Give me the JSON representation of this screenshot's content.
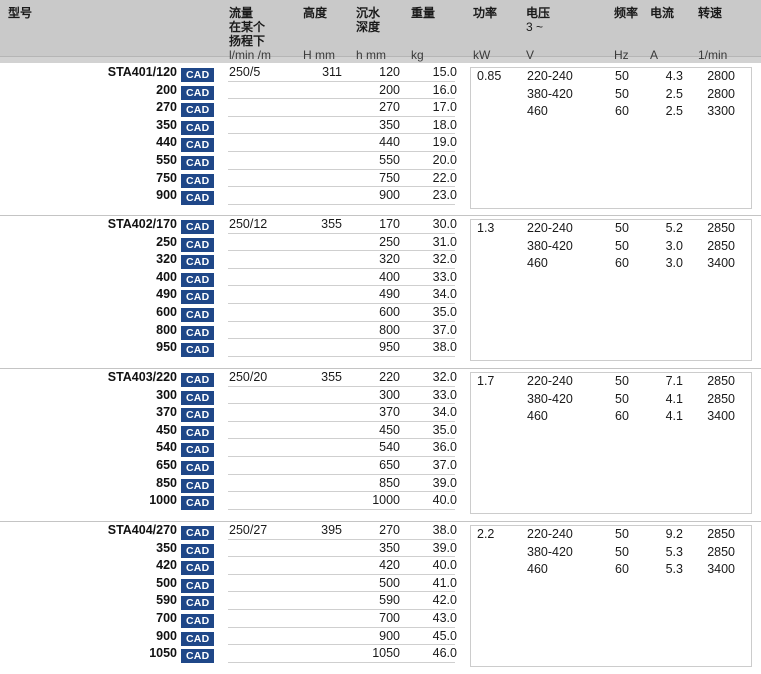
{
  "table": {
    "columns": [
      {
        "key": "model",
        "zh": "型号",
        "sub": "",
        "unit": ""
      },
      {
        "key": "flow",
        "zh": "流量",
        "sub2": "在某个",
        "sub3": "扬程下",
        "unit": "l/min /m"
      },
      {
        "key": "height",
        "zh": "高度",
        "unit": "H mm"
      },
      {
        "key": "depth",
        "zh": "沉水",
        "sub2": "深度",
        "unit": "h mm"
      },
      {
        "key": "weight",
        "zh": "重量",
        "unit": "kg"
      },
      {
        "key": "power",
        "zh": "功率",
        "unit": "kW"
      },
      {
        "key": "voltage",
        "zh": "电压",
        "sub2": "3 ~",
        "unit": "V"
      },
      {
        "key": "freq",
        "zh": "频率",
        "unit": "Hz"
      },
      {
        "key": "current",
        "zh": "电流",
        "unit": "A"
      },
      {
        "key": "speed",
        "zh": "转速",
        "unit": "1/min"
      }
    ],
    "cad_label": "CAD",
    "accent_color": "#1f4788",
    "header_bg": "#c9c9c9",
    "blocks": [
      {
        "rows": [
          {
            "model": "STA401/120",
            "cad": "CAD",
            "flow": "250/5",
            "height": "311",
            "depth": "120",
            "weight": "15.0"
          },
          {
            "model": "200",
            "cad": "CAD",
            "flow": "",
            "height": "",
            "depth": "200",
            "weight": "16.0"
          },
          {
            "model": "270",
            "cad": "CAD",
            "flow": "",
            "height": "",
            "depth": "270",
            "weight": "17.0"
          },
          {
            "model": "350",
            "cad": "CAD",
            "flow": "",
            "height": "",
            "depth": "350",
            "weight": "18.0"
          },
          {
            "model": "440",
            "cad": "CAD",
            "flow": "",
            "height": "",
            "depth": "440",
            "weight": "19.0"
          },
          {
            "model": "550",
            "cad": "CAD",
            "flow": "",
            "height": "",
            "depth": "550",
            "weight": "20.0"
          },
          {
            "model": "750",
            "cad": "CAD",
            "flow": "",
            "height": "",
            "depth": "750",
            "weight": "22.0"
          },
          {
            "model": "900",
            "cad": "CAD",
            "flow": "",
            "height": "",
            "depth": "900",
            "weight": "23.0"
          }
        ],
        "electrical": [
          {
            "power": "0.85",
            "voltage": "220-240",
            "freq": "50",
            "current": "4.3",
            "speed": "2800"
          },
          {
            "power": "",
            "voltage": "380-420",
            "freq": "50",
            "current": "2.5",
            "speed": "2800"
          },
          {
            "power": "",
            "voltage": "460",
            "freq": "60",
            "current": "2.5",
            "speed": "3300"
          }
        ]
      },
      {
        "rows": [
          {
            "model": "STA402/170",
            "cad": "CAD",
            "flow": "250/12",
            "height": "355",
            "depth": "170",
            "weight": "30.0"
          },
          {
            "model": "250",
            "cad": "CAD",
            "flow": "",
            "height": "",
            "depth": "250",
            "weight": "31.0"
          },
          {
            "model": "320",
            "cad": "CAD",
            "flow": "",
            "height": "",
            "depth": "320",
            "weight": "32.0"
          },
          {
            "model": "400",
            "cad": "CAD",
            "flow": "",
            "height": "",
            "depth": "400",
            "weight": "33.0"
          },
          {
            "model": "490",
            "cad": "CAD",
            "flow": "",
            "height": "",
            "depth": "490",
            "weight": "34.0"
          },
          {
            "model": "600",
            "cad": "CAD",
            "flow": "",
            "height": "",
            "depth": "600",
            "weight": "35.0"
          },
          {
            "model": "800",
            "cad": "CAD",
            "flow": "",
            "height": "",
            "depth": "800",
            "weight": "37.0"
          },
          {
            "model": "950",
            "cad": "CAD",
            "flow": "",
            "height": "",
            "depth": "950",
            "weight": "38.0"
          }
        ],
        "electrical": [
          {
            "power": "1.3",
            "voltage": "220-240",
            "freq": "50",
            "current": "5.2",
            "speed": "2850"
          },
          {
            "power": "",
            "voltage": "380-420",
            "freq": "50",
            "current": "3.0",
            "speed": "2850"
          },
          {
            "power": "",
            "voltage": "460",
            "freq": "60",
            "current": "3.0",
            "speed": "3400"
          }
        ]
      },
      {
        "rows": [
          {
            "model": "STA403/220",
            "cad": "CAD",
            "flow": "250/20",
            "height": "355",
            "depth": "220",
            "weight": "32.0"
          },
          {
            "model": "300",
            "cad": "CAD",
            "flow": "",
            "height": "",
            "depth": "300",
            "weight": "33.0"
          },
          {
            "model": "370",
            "cad": "CAD",
            "flow": "",
            "height": "",
            "depth": "370",
            "weight": "34.0"
          },
          {
            "model": "450",
            "cad": "CAD",
            "flow": "",
            "height": "",
            "depth": "450",
            "weight": "35.0"
          },
          {
            "model": "540",
            "cad": "CAD",
            "flow": "",
            "height": "",
            "depth": "540",
            "weight": "36.0"
          },
          {
            "model": "650",
            "cad": "CAD",
            "flow": "",
            "height": "",
            "depth": "650",
            "weight": "37.0"
          },
          {
            "model": "850",
            "cad": "CAD",
            "flow": "",
            "height": "",
            "depth": "850",
            "weight": "39.0"
          },
          {
            "model": "1000",
            "cad": "CAD",
            "flow": "",
            "height": "",
            "depth": "1000",
            "weight": "40.0"
          }
        ],
        "electrical": [
          {
            "power": "1.7",
            "voltage": "220-240",
            "freq": "50",
            "current": "7.1",
            "speed": "2850"
          },
          {
            "power": "",
            "voltage": "380-420",
            "freq": "50",
            "current": "4.1",
            "speed": "2850"
          },
          {
            "power": "",
            "voltage": "460",
            "freq": "60",
            "current": "4.1",
            "speed": "3400"
          }
        ]
      },
      {
        "rows": [
          {
            "model": "STA404/270",
            "cad": "CAD",
            "flow": "250/27",
            "height": "395",
            "depth": "270",
            "weight": "38.0"
          },
          {
            "model": "350",
            "cad": "CAD",
            "flow": "",
            "height": "",
            "depth": "350",
            "weight": "39.0"
          },
          {
            "model": "420",
            "cad": "CAD",
            "flow": "",
            "height": "",
            "depth": "420",
            "weight": "40.0"
          },
          {
            "model": "500",
            "cad": "CAD",
            "flow": "",
            "height": "",
            "depth": "500",
            "weight": "41.0"
          },
          {
            "model": "590",
            "cad": "CAD",
            "flow": "",
            "height": "",
            "depth": "590",
            "weight": "42.0"
          },
          {
            "model": "700",
            "cad": "CAD",
            "flow": "",
            "height": "",
            "depth": "700",
            "weight": "43.0"
          },
          {
            "model": "900",
            "cad": "CAD",
            "flow": "",
            "height": "",
            "depth": "900",
            "weight": "45.0"
          },
          {
            "model": "1050",
            "cad": "CAD",
            "flow": "",
            "height": "",
            "depth": "1050",
            "weight": "46.0"
          }
        ],
        "electrical": [
          {
            "power": "2.2",
            "voltage": "220-240",
            "freq": "50",
            "current": "9.2",
            "speed": "2850"
          },
          {
            "power": "",
            "voltage": "380-420",
            "freq": "50",
            "current": "5.3",
            "speed": "2850"
          },
          {
            "power": "",
            "voltage": "460",
            "freq": "60",
            "current": "5.3",
            "speed": "3400"
          }
        ]
      }
    ]
  }
}
